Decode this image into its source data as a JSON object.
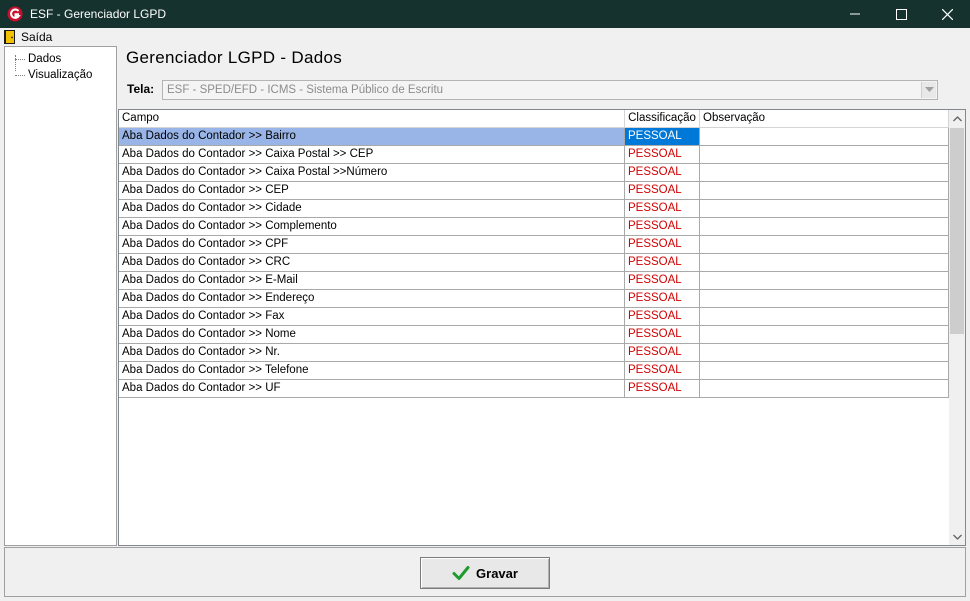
{
  "window": {
    "title": "ESF - Gerenciador LGPD"
  },
  "menu": {
    "exit_label": "Saída"
  },
  "sidebar": {
    "items": [
      {
        "label": "Dados"
      },
      {
        "label": "Visualização"
      }
    ]
  },
  "main": {
    "title": "Gerenciador LGPD - Dados",
    "tela": {
      "label": "Tela:",
      "value": "ESF - SPED/EFD - ICMS - Sistema Público de Escritu"
    },
    "grid": {
      "columns": [
        "Campo",
        "Classificação",
        "Observação"
      ],
      "rows": [
        {
          "campo": "Aba Dados do Contador >> Bairro",
          "classificacao": "PESSOAL",
          "observacao": ""
        },
        {
          "campo": "Aba Dados do Contador >> Caixa Postal >> CEP",
          "classificacao": "PESSOAL",
          "observacao": ""
        },
        {
          "campo": "Aba Dados do Contador >> Caixa Postal >>Número",
          "classificacao": "PESSOAL",
          "observacao": ""
        },
        {
          "campo": "Aba Dados do Contador >> CEP",
          "classificacao": "PESSOAL",
          "observacao": ""
        },
        {
          "campo": "Aba Dados do Contador >> Cidade",
          "classificacao": "PESSOAL",
          "observacao": ""
        },
        {
          "campo": "Aba Dados do Contador >> Complemento",
          "classificacao": "PESSOAL",
          "observacao": ""
        },
        {
          "campo": "Aba Dados do Contador >> CPF",
          "classificacao": "PESSOAL",
          "observacao": ""
        },
        {
          "campo": "Aba Dados do Contador >> CRC",
          "classificacao": "PESSOAL",
          "observacao": ""
        },
        {
          "campo": "Aba Dados do Contador >> E-Mail",
          "classificacao": "PESSOAL",
          "observacao": ""
        },
        {
          "campo": "Aba Dados do Contador >> Endereço",
          "classificacao": "PESSOAL",
          "observacao": ""
        },
        {
          "campo": "Aba Dados do Contador >> Fax",
          "classificacao": "PESSOAL",
          "observacao": ""
        },
        {
          "campo": "Aba Dados do Contador >> Nome",
          "classificacao": "PESSOAL",
          "observacao": ""
        },
        {
          "campo": "Aba Dados do Contador >> Nr.",
          "classificacao": "PESSOAL",
          "observacao": ""
        },
        {
          "campo": "Aba Dados do Contador >> Telefone",
          "classificacao": "PESSOAL",
          "observacao": ""
        },
        {
          "campo": "Aba Dados do Contador >> UF",
          "classificacao": "PESSOAL",
          "observacao": ""
        }
      ],
      "selected_row": 0
    }
  },
  "footer": {
    "save_label": "Gravar",
    "save_icon": "checkmark-icon"
  },
  "colors": {
    "titlebar": "#15322f",
    "classification_text": "#d20000",
    "selected_row": "#99b4e6",
    "selected_cell": "#0078d7"
  }
}
